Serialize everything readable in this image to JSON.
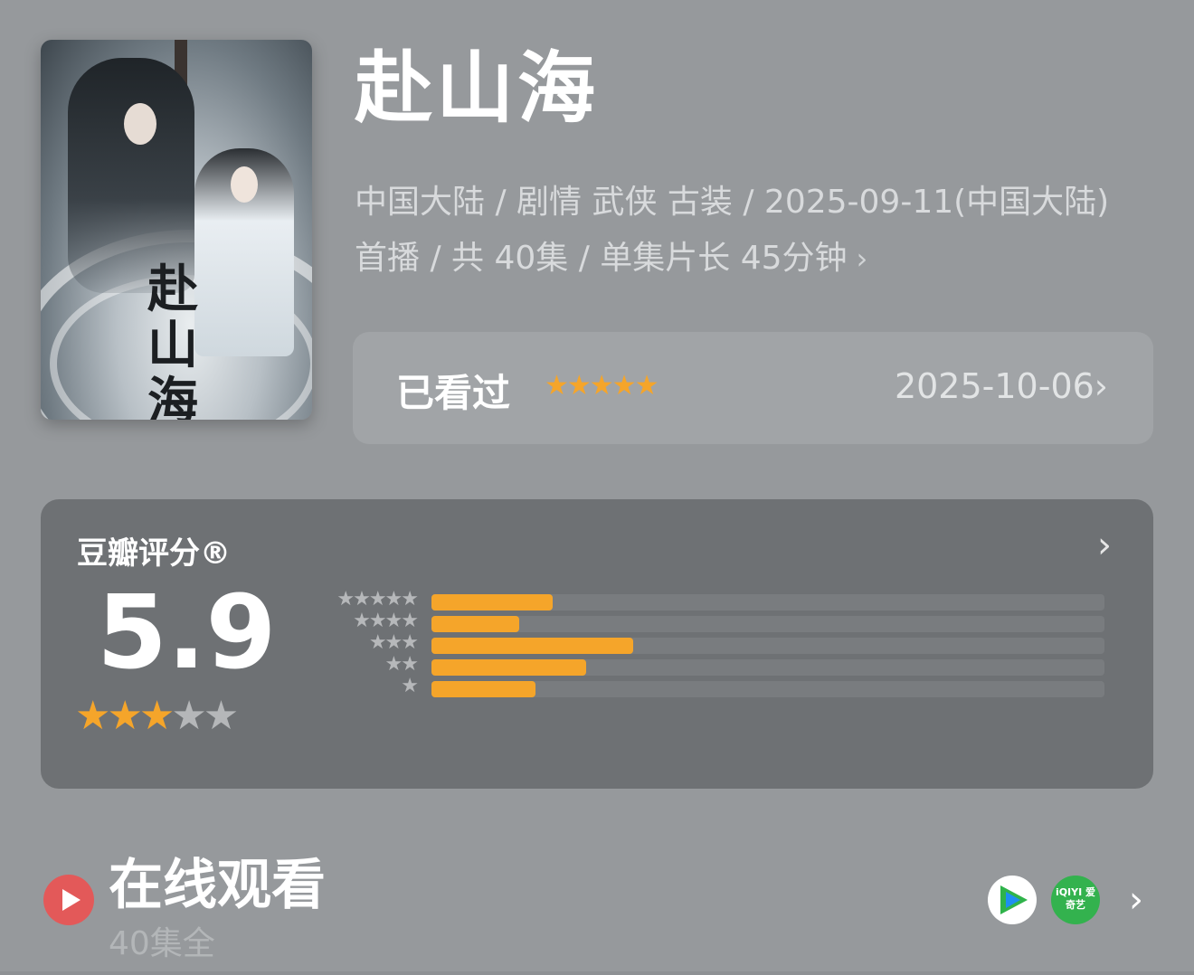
{
  "movie": {
    "title": "赴山海",
    "poster_text": [
      "赴",
      "山",
      "海"
    ],
    "meta_text": "中国大陆 / 剧情 武侠 古装 / 2025-09-11(中国大陆) 首播 / 共 40集 / 单集片长 45分钟",
    "meta_chevron": "›"
  },
  "watched": {
    "label": "已看过",
    "stars": "★★★★★",
    "date": "2025-10-06",
    "chevron": "›"
  },
  "rating": {
    "heading": "豆瓣评分®",
    "chevron": "›",
    "score": "5.9",
    "stars_on": "★★★",
    "stars_off": "★★",
    "distribution": [
      {
        "stars": "★★★★★",
        "fraction": 0.18
      },
      {
        "stars": "★★★★",
        "fraction": 0.13
      },
      {
        "stars": "★★★",
        "fraction": 0.3
      },
      {
        "stars": "★★",
        "fraction": 0.23
      },
      {
        "stars": "★",
        "fraction": 0.155
      }
    ]
  },
  "watch_online": {
    "title": "在线观看",
    "subtitle": "40集全",
    "platforms": [
      {
        "name": "tencent-video"
      },
      {
        "name": "iqiyi",
        "label": "iQIYI 爱奇艺"
      }
    ],
    "chevron": "›"
  }
}
